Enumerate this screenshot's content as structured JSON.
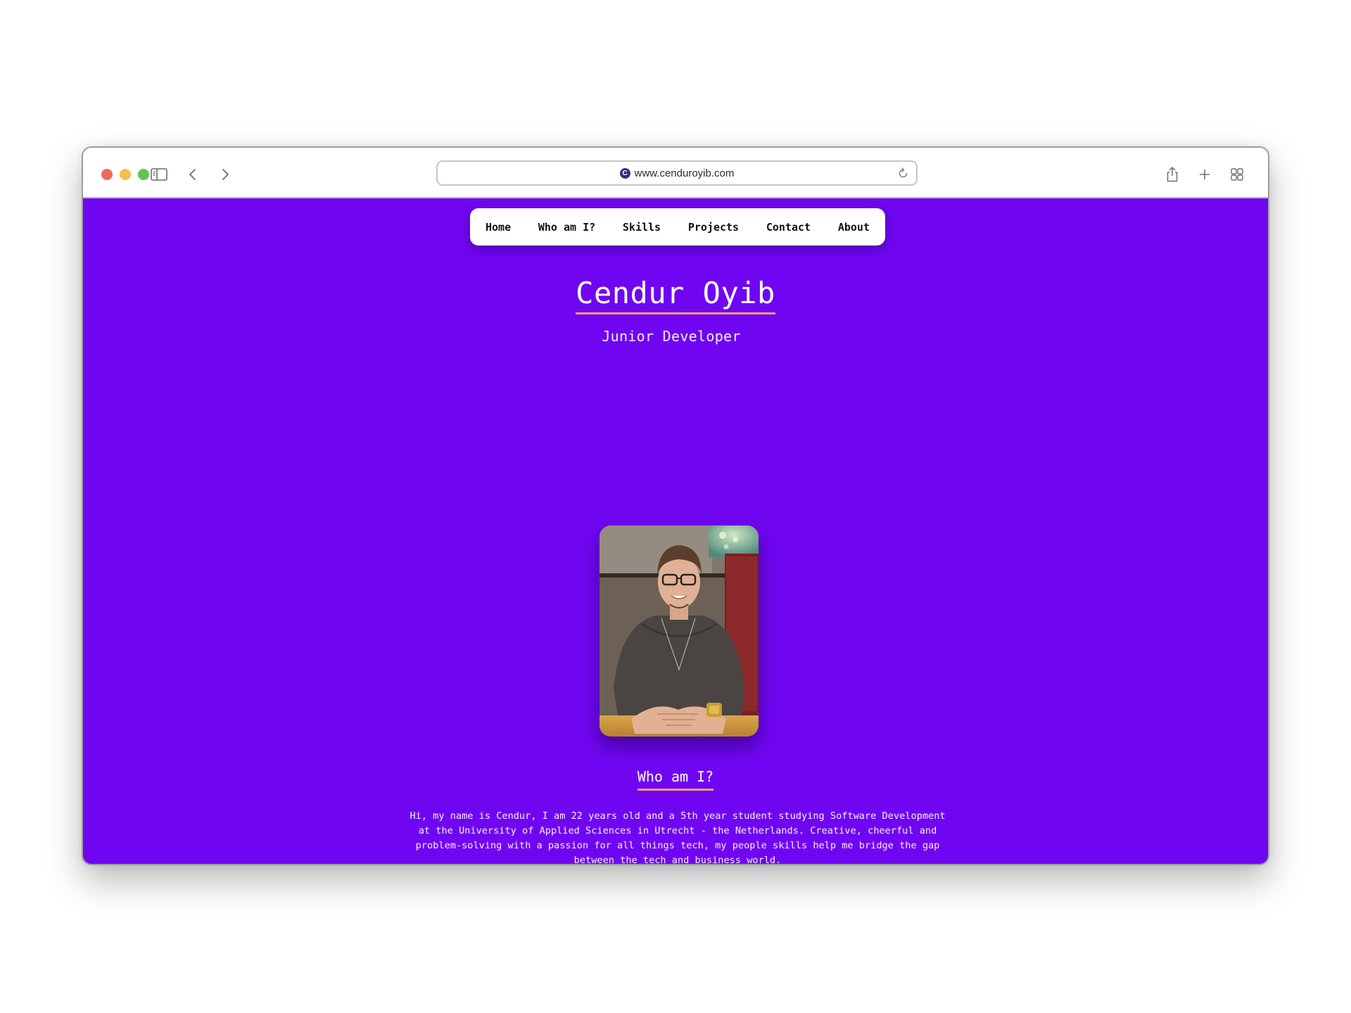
{
  "browser": {
    "url": "www.cenduroyib.com",
    "favicon_letter": "C",
    "icons": {
      "sidebar": "sidebar-icon",
      "back": "chevron-left-icon",
      "forward": "chevron-right-icon",
      "reload": "reload-icon",
      "share": "share-icon",
      "new_tab": "plus-icon",
      "tab_overview": "grid-icon"
    }
  },
  "colors": {
    "page_background": "#7006f1",
    "accent_underline": "#f59a6b",
    "nav_background": "#ffffff",
    "nav_text": "#111111"
  },
  "nav": {
    "items": [
      {
        "label": "Home"
      },
      {
        "label": "Who am I?"
      },
      {
        "label": "Skills"
      },
      {
        "label": "Projects"
      },
      {
        "label": "Contact"
      },
      {
        "label": "About"
      }
    ]
  },
  "hero": {
    "name": "Cendur Oyib",
    "role": "Junior Developer",
    "photo_alt": "Portrait photo of a smiling young man with glasses in a dark sweater"
  },
  "about": {
    "heading": "Who am I?",
    "lines": [
      "Hi, my name is Cendur, I am 22 years old and a 5th year student studying Software Development",
      "at the University of Applied Sciences in Utrecht - the Netherlands. Creative, cheerful and",
      "problem-solving with a passion for all things tech, my people skills help me bridge the gap",
      "between the tech and business world."
    ]
  }
}
